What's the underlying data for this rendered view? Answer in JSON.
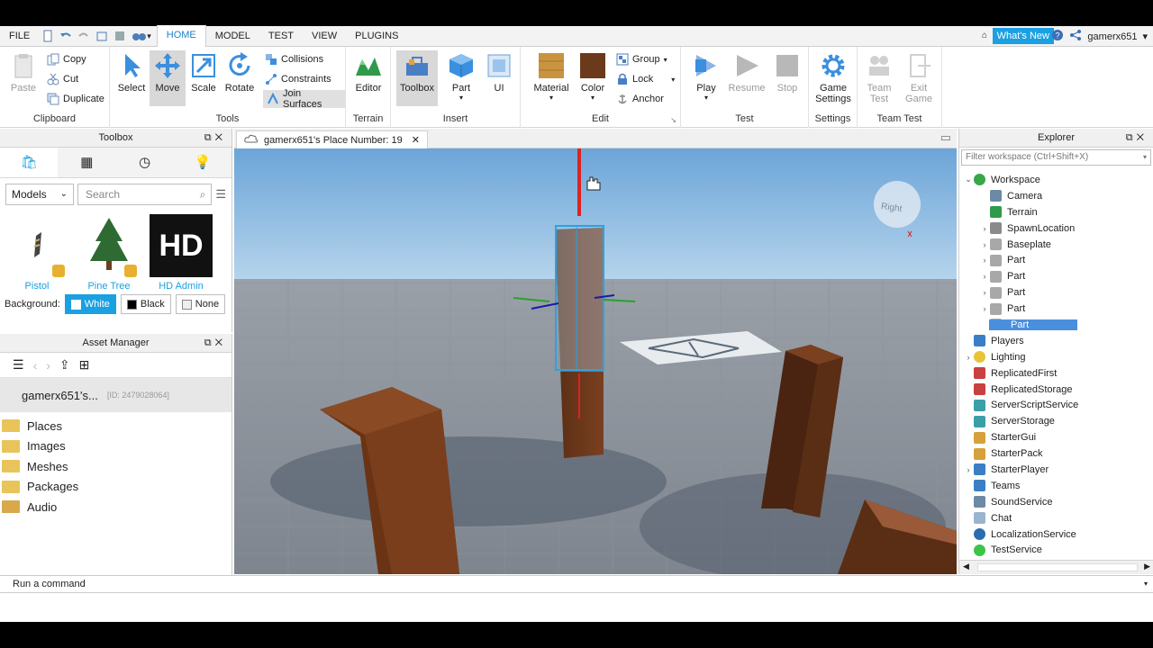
{
  "menubar": {
    "file": "FILE",
    "tabs": [
      "HOME",
      "MODEL",
      "TEST",
      "VIEW",
      "PLUGINS"
    ],
    "whats_new": "What's New",
    "username": "gamerx651"
  },
  "ribbon": {
    "clipboard": {
      "label": "Clipboard",
      "paste": "Paste",
      "copy": "Copy",
      "cut": "Cut",
      "duplicate": "Duplicate"
    },
    "tools": {
      "label": "Tools",
      "select": "Select",
      "move": "Move",
      "scale": "Scale",
      "rotate": "Rotate",
      "collisions": "Collisions",
      "constraints": "Constraints",
      "join_surfaces": "Join Surfaces"
    },
    "terrain": {
      "label": "Terrain",
      "editor": "Editor"
    },
    "insert": {
      "label": "Insert",
      "toolbox": "Toolbox",
      "part": "Part",
      "ui": "UI"
    },
    "edit": {
      "label": "Edit",
      "material": "Material",
      "color": "Color",
      "group": "Group",
      "lock": "Lock",
      "anchor": "Anchor"
    },
    "test": {
      "label": "Test",
      "play": "Play",
      "resume": "Resume",
      "stop": "Stop"
    },
    "settings": {
      "label": "Settings",
      "game_settings": "Game Settings"
    },
    "team_test": {
      "label": "Team Test",
      "team_test_btn": "Team Test",
      "exit_game": "Exit Game"
    }
  },
  "toolbox": {
    "title": "Toolbox",
    "category": "Models",
    "search_placeholder": "Search",
    "items": [
      "Pistol",
      "Pine Tree",
      "HD Admin"
    ],
    "hd_logo": "HD",
    "background_label": "Background:",
    "bg_options": [
      "White",
      "Black",
      "None"
    ]
  },
  "asset_manager": {
    "title": "Asset Manager",
    "root_name": "gamerx651's...",
    "root_id": "[ID: 2479028064]",
    "folders": [
      "Places",
      "Images",
      "Meshes",
      "Packages",
      "Audio"
    ]
  },
  "document_tab": {
    "title": "gamerx651's Place Number: 19"
  },
  "viewport": {
    "view_cube_label": "Right"
  },
  "explorer": {
    "title": "Explorer",
    "filter_placeholder": "Filter workspace (Ctrl+Shift+X)",
    "items": [
      {
        "label": "Workspace",
        "indent": 0,
        "expand": "open",
        "icon": "globe-icon",
        "color": "#3aa64a"
      },
      {
        "label": "Camera",
        "indent": 1,
        "expand": "",
        "icon": "camera-icon",
        "color": "#6b8aa6"
      },
      {
        "label": "Terrain",
        "indent": 1,
        "expand": "",
        "icon": "terrain-icon",
        "color": "#2f9a4a"
      },
      {
        "label": "SpawnLocation",
        "indent": 1,
        "expand": "closed",
        "icon": "spawn-icon",
        "color": "#8a8a8a"
      },
      {
        "label": "Baseplate",
        "indent": 1,
        "expand": "closed",
        "icon": "part-icon",
        "color": "#a8a8a8"
      },
      {
        "label": "Part",
        "indent": 1,
        "expand": "closed",
        "icon": "part-icon",
        "color": "#a8a8a8"
      },
      {
        "label": "Part",
        "indent": 1,
        "expand": "closed",
        "icon": "part-icon",
        "color": "#a8a8a8"
      },
      {
        "label": "Part",
        "indent": 1,
        "expand": "closed",
        "icon": "part-icon",
        "color": "#a8a8a8"
      },
      {
        "label": "Part",
        "indent": 1,
        "expand": "closed",
        "icon": "part-icon",
        "color": "#a8a8a8"
      },
      {
        "label": "Part",
        "indent": 1,
        "expand": "",
        "icon": "part-icon",
        "color": "#a8a8a8",
        "selected": true
      },
      {
        "label": "Players",
        "indent": 0,
        "expand": "",
        "icon": "players-icon",
        "color": "#3a7fc6"
      },
      {
        "label": "Lighting",
        "indent": 0,
        "expand": "closed",
        "icon": "lighting-icon",
        "color": "#e8c33a"
      },
      {
        "label": "ReplicatedFirst",
        "indent": 0,
        "expand": "",
        "icon": "replicated-first-icon",
        "color": "#c84040"
      },
      {
        "label": "ReplicatedStorage",
        "indent": 0,
        "expand": "",
        "icon": "replicated-storage-icon",
        "color": "#c84040"
      },
      {
        "label": "ServerScriptService",
        "indent": 0,
        "expand": "",
        "icon": "server-script-icon",
        "color": "#3aa0a6"
      },
      {
        "label": "ServerStorage",
        "indent": 0,
        "expand": "",
        "icon": "server-storage-icon",
        "color": "#3aa0a6"
      },
      {
        "label": "StarterGui",
        "indent": 0,
        "expand": "",
        "icon": "starter-gui-icon",
        "color": "#d6a13a"
      },
      {
        "label": "StarterPack",
        "indent": 0,
        "expand": "",
        "icon": "starter-pack-icon",
        "color": "#d6a13a"
      },
      {
        "label": "StarterPlayer",
        "indent": 0,
        "expand": "closed",
        "icon": "starter-player-icon",
        "color": "#3a7fc6"
      },
      {
        "label": "Teams",
        "indent": 0,
        "expand": "",
        "icon": "teams-icon",
        "color": "#3a7fc6"
      },
      {
        "label": "SoundService",
        "indent": 0,
        "expand": "",
        "icon": "sound-icon",
        "color": "#6b8aa6"
      },
      {
        "label": "Chat",
        "indent": 0,
        "expand": "",
        "icon": "chat-icon",
        "color": "#9ab4cf"
      },
      {
        "label": "LocalizationService",
        "indent": 0,
        "expand": "",
        "icon": "localization-icon",
        "color": "#2b6cb0"
      },
      {
        "label": "TestService",
        "indent": 0,
        "expand": "",
        "icon": "test-service-icon",
        "color": "#3ac44a"
      }
    ]
  },
  "command_bar": {
    "placeholder": "Run a command"
  }
}
